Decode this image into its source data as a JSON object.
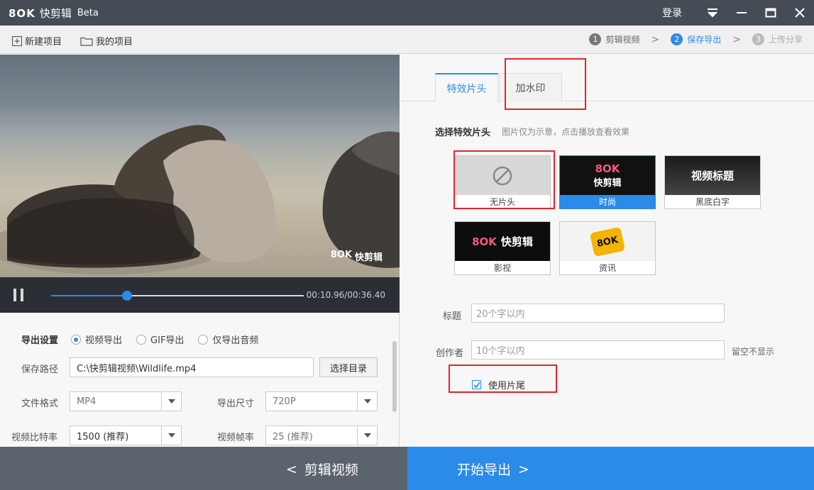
{
  "app": {
    "logo_mark": "8OK",
    "name": "快剪辑",
    "edition": "Beta",
    "login": "登录"
  },
  "toolbar": {
    "new_project": "新建项目",
    "my_projects": "我的项目"
  },
  "steps": [
    {
      "num": "1",
      "label": "剪辑视频"
    },
    {
      "num": "2",
      "label": "保存导出"
    },
    {
      "num": "3",
      "label": "上传分享"
    }
  ],
  "player": {
    "watermark_mark": "8OK",
    "watermark_name": "快剪辑",
    "time": "00:10.96/00:36.40",
    "progress": 0.301
  },
  "export": {
    "title": "导出设置",
    "modes": [
      "视频导出",
      "GIF导出",
      "仅导出音频"
    ],
    "selected_mode": "视频导出",
    "path_label": "保存路径",
    "path_value": "C:\\快剪辑视频\\Wildlife.mp4",
    "choose_dir": "选择目录",
    "format_label": "文件格式",
    "format_value": "MP4",
    "size_label": "导出尺寸",
    "size_value": "720P",
    "bitrate_label": "视频比特率",
    "bitrate_value": "1500 (推荐)",
    "fps_label": "视频帧率",
    "fps_value": "25 (推荐)"
  },
  "tabs": [
    "特效片头",
    "加水印"
  ],
  "intro": {
    "title": "选择特效片头",
    "hint": "图片仅为示意，点击播放查看效果",
    "cards": [
      {
        "caption": "无片头"
      },
      {
        "caption": "时尚",
        "thumb_mark": "8OK",
        "thumb_text": "快剪辑"
      },
      {
        "caption": "黑底白字",
        "thumb_text": "视频标题"
      },
      {
        "caption": "影视",
        "thumb_mark": "8OK",
        "thumb_text": "快剪辑"
      },
      {
        "caption": "资讯",
        "thumb_mark": "8OK"
      }
    ],
    "selected": "时尚"
  },
  "form": {
    "title_label": "标题",
    "title_placeholder": "20个字以内",
    "author_label": "创作者",
    "author_placeholder": "10个字以内",
    "author_hint": "留空不显示",
    "use_outro": "使用片尾",
    "use_outro_checked": true
  },
  "bottom": {
    "back": "剪辑视频",
    "export": "开始导出"
  },
  "colors": {
    "accent": "#2b8be8",
    "titlebar": "#454c56",
    "highlight": "#e0262b"
  }
}
